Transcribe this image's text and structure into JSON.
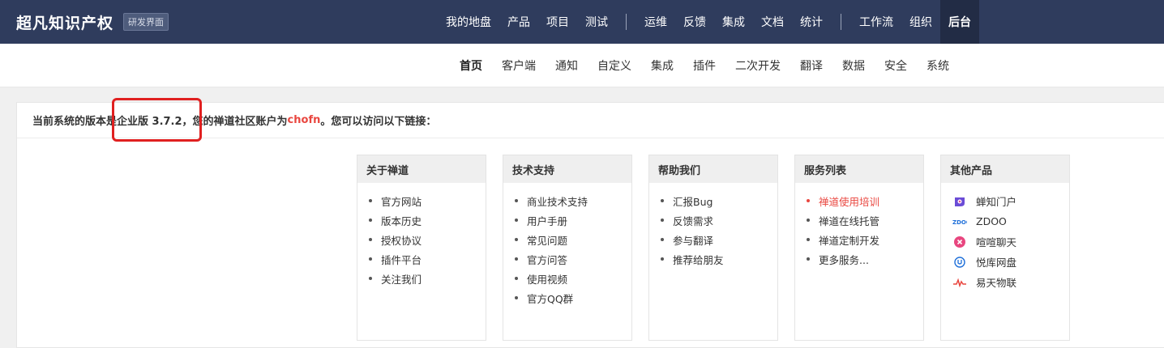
{
  "brand": {
    "name": "超凡知识产权",
    "badge": "研发界面"
  },
  "main_nav": [
    "我的地盘",
    "产品",
    "项目",
    "测试",
    "运维",
    "反馈",
    "集成",
    "文档",
    "统计",
    "工作流",
    "组织",
    "后台"
  ],
  "main_nav_active": "后台",
  "sub_nav": [
    "首页",
    "客户端",
    "通知",
    "自定义",
    "集成",
    "插件",
    "二次开发",
    "翻译",
    "数据",
    "安全",
    "系统"
  ],
  "sub_nav_active": "首页",
  "info": {
    "prefix": "当前系统的版本是企业版 3.7.2，您的禅道社区账户为",
    "account": "chofn",
    "suffix": "。您可以访问以下链接："
  },
  "cards": {
    "about": {
      "title": "关于禅道",
      "items": [
        "官方网站",
        "版本历史",
        "授权协议",
        "插件平台",
        "关注我们"
      ]
    },
    "support": {
      "title": "技术支持",
      "items": [
        "商业技术支持",
        "用户手册",
        "常见问题",
        "官方问答",
        "使用视频",
        "官方QQ群"
      ]
    },
    "help": {
      "title": "帮助我们",
      "items": [
        "汇报Bug",
        "反馈需求",
        "参与翻译",
        "推荐给朋友"
      ]
    },
    "services": {
      "title": "服务列表",
      "items": [
        "禅道使用培训",
        "禅道在线托管",
        "禅道定制开发",
        "更多服务..."
      ]
    },
    "products": {
      "title": "其他产品",
      "items": [
        {
          "label": "蝉知门户",
          "icon": "chanzhi-icon"
        },
        {
          "label": "ZDOO",
          "icon": "zdoo-icon"
        },
        {
          "label": "喧喧聊天",
          "icon": "xuanxuan-icon"
        },
        {
          "label": "悦库网盘",
          "icon": "yueku-icon"
        },
        {
          "label": "易天物联",
          "icon": "yitian-icon"
        }
      ]
    }
  },
  "colors": {
    "topbar": "#2f3c5d",
    "accent_red": "#e9463f",
    "annotation_red": "#e02020"
  }
}
